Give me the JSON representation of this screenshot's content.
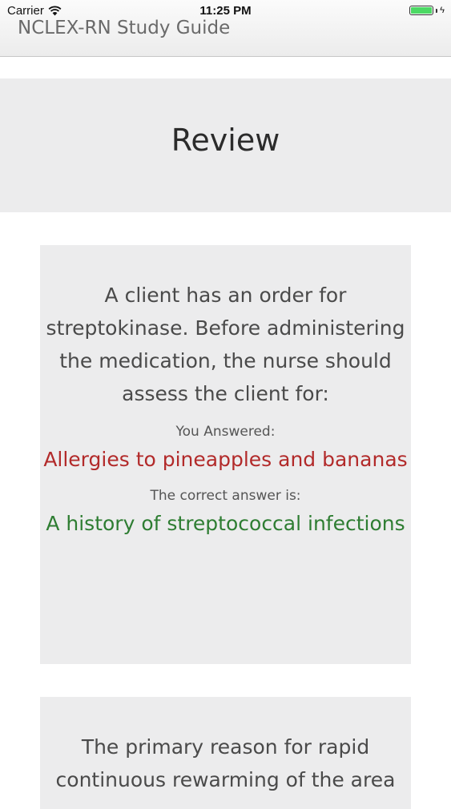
{
  "status_bar": {
    "carrier": "Carrier",
    "time": "11:25 PM",
    "battery_color": "#4cd964"
  },
  "nav": {
    "title": "NCLEX-RN Study Guide"
  },
  "review": {
    "title": "Review"
  },
  "questions": [
    {
      "question": "A client has an order for streptokinase. Before administering the medication, the nurse should assess the client for:",
      "you_answered_label": "You Answered:",
      "you_answered": "Allergies to pineapples and bananas",
      "correct_label": "The correct answer is:",
      "correct_answer": "A history of streptococcal infections"
    },
    {
      "question": "The primary reason for rapid continuous rewarming of the area"
    }
  ],
  "colors": {
    "wrong": "#b22a2a",
    "correct": "#2e7d32"
  }
}
